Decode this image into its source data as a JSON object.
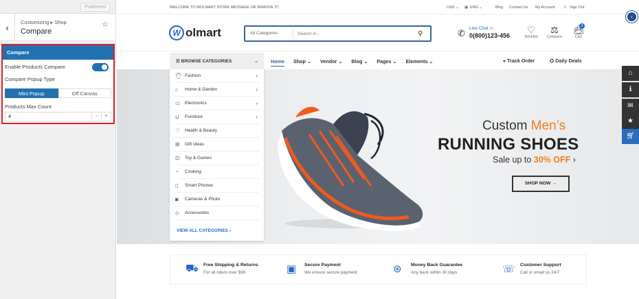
{
  "customizer": {
    "published_label": "Published",
    "back_glyph": "‹",
    "breadcrumb": "Customizing ▸ Shop",
    "title": "Compare",
    "section_title": "Compare",
    "enable_label": "Enable Products Compare",
    "enable_checked": true,
    "popup_type_label": "Compare Popup Type",
    "popup_options": [
      "Mini Popup",
      "Off Canvas"
    ],
    "popup_selected": "Mini Popup",
    "max_count_label": "Products Max Count",
    "max_count_value": "4",
    "minus": "-",
    "plus": "+",
    "accent_color": "#2271b1",
    "highlight_color": "#e31e24"
  },
  "site": {
    "topbar": {
      "message": "WELCOME TO WOLMART STORE MESSAGE OR REMOVE IT!",
      "currency": "USD ⌄",
      "language": "ENG ⌄",
      "links": [
        "Blog",
        "Contact Us",
        "My Account"
      ],
      "signout": "Sign Out"
    },
    "logo_text": "olmart",
    "logo_letter": "W",
    "search": {
      "category": "All Categories",
      "placeholder": "Search in..."
    },
    "contact": {
      "live_chat": "Live Chat",
      "or": "or :",
      "phone": "0(800)123-456"
    },
    "header_icons": [
      {
        "label": "Wishlist",
        "icon": "heart-icon"
      },
      {
        "label": "Compare",
        "icon": "compare-icon"
      },
      {
        "label": "Cart",
        "icon": "bag-icon",
        "badge": "0"
      }
    ],
    "browse_label": "BROWSE CATEGORIES",
    "nav": [
      "Home",
      "Shop ⌄",
      "Vendor ⌄",
      "Blog ⌄",
      "Pages ⌄",
      "Elements ⌄"
    ],
    "nav_active": "Home",
    "track_order": "Track Order",
    "daily_deals": "Daily Deals",
    "categories": [
      {
        "label": "Fashion",
        "icon": "shirt-icon",
        "sub": true
      },
      {
        "label": "Home & Garden",
        "icon": "home-icon",
        "sub": true
      },
      {
        "label": "Electronics",
        "icon": "monitor-icon",
        "sub": true
      },
      {
        "label": "Furniture",
        "icon": "sofa-icon",
        "sub": true
      },
      {
        "label": "Health & Beauty",
        "icon": "heart-pulse-icon",
        "sub": false
      },
      {
        "label": "Gift Ideas",
        "icon": "gift-icon",
        "sub": false
      },
      {
        "label": "Toy & Games",
        "icon": "gamepad-icon",
        "sub": false
      },
      {
        "label": "Cooking",
        "icon": "cooking-icon",
        "sub": false
      },
      {
        "label": "Smart Phones",
        "icon": "phone-icon",
        "sub": false
      },
      {
        "label": "Cameras & Photo",
        "icon": "camera-icon",
        "sub": false
      },
      {
        "label": "Accessories",
        "icon": "diamond-icon",
        "sub": false
      }
    ],
    "view_all": "VIEW ALL CATEGORIES ›",
    "hero": {
      "line1_pre": "Custom ",
      "line1_accent": "Men’s",
      "line2": "RUNNING SHOES",
      "sale_pre": "Sale up to ",
      "sale_accent": "30% OFF",
      "sale_post": " ›",
      "button": "SHOP NOW →",
      "accent_color": "#f57d20"
    },
    "features": [
      {
        "title": "Free Shipping & Returns",
        "desc": "For all oders over $99",
        "icon": "truck-icon"
      },
      {
        "title": "Secure Payment",
        "desc": "We ensure secure payment",
        "icon": "wallet-icon"
      },
      {
        "title": "Money Back Guarantee",
        "desc": "Any back within 30 days",
        "icon": "money-back-icon"
      },
      {
        "title": "Customer Support",
        "desc": "Call or email us 24/7",
        "icon": "chat-icon"
      }
    ],
    "floating_buttons": [
      "home-icon",
      "info-icon",
      "chat-icon",
      "star-icon",
      "cart-icon"
    ]
  }
}
